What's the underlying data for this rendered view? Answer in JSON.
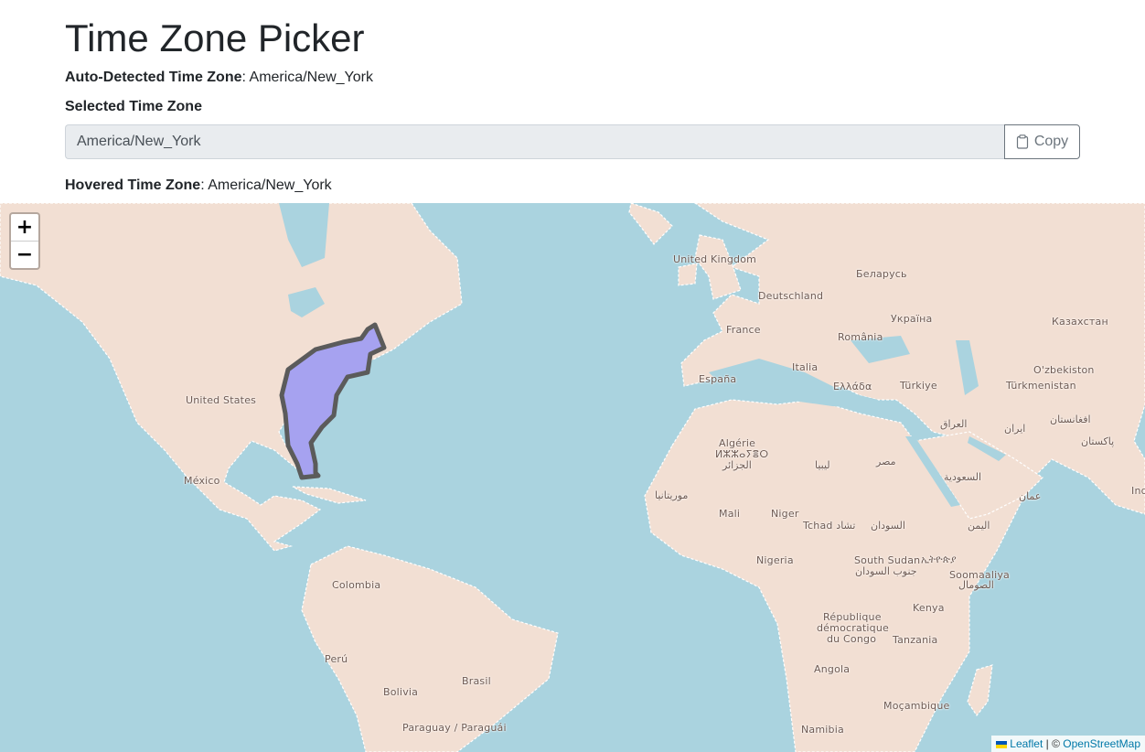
{
  "header": {
    "title": "Time Zone Picker"
  },
  "auto_detected": {
    "label": "Auto-Detected Time Zone",
    "value": "America/New_York"
  },
  "selected": {
    "label": "Selected Time Zone",
    "value": "America/New_York",
    "copy_label": "Copy"
  },
  "hovered": {
    "label": "Hovered Time Zone",
    "value": "America/New_York"
  },
  "map": {
    "zoom_in": "+",
    "zoom_out": "−",
    "highlight_color": "#a6a2f0",
    "attribution": {
      "leaflet": "Leaflet",
      "separator": " | © ",
      "osm": "OpenStreetMap"
    },
    "labels": {
      "united_kingdom": "United Kingdom",
      "belarus": "Беларусь",
      "deutschland": "Deutschland",
      "ukraine": "Україна",
      "kazakhstan": "Казахстан",
      "france": "France",
      "romania": "România",
      "uzbekistan": "O'zbekiston",
      "espana": "España",
      "italia": "Italia",
      "turkmenistan": "Türkmenistan",
      "ellada": "Ελλάδα",
      "turkiye": "Türkiye",
      "united_states": "United States",
      "iraq": "العراق",
      "iran": "ایران",
      "afghanistan": "افغانستان",
      "pakistan": "پاکستان",
      "algerie": "Algérie",
      "algerie_tif": "ⵍⵣⵣⴰⵢⴻⵔ",
      "algerie_ar": "الجزائر",
      "libya": "ليبيا",
      "misr": "مصر",
      "saudi": "السعودية",
      "mexico": "México",
      "oman": "عمان",
      "india": "Ind",
      "mauritania": "موريتانيا",
      "mali": "Mali",
      "niger": "Niger",
      "tchad": "Tchad تشاد",
      "sudan": "السودان",
      "yemen": "اليمن",
      "nigeria": "Nigeria",
      "south_sudan": "South Sudan",
      "south_sudan_ar": "جنوب السودان",
      "ethiopia": "ኢትዮጵያ",
      "somalia": "Soomaaliya",
      "somalia_ar": "الصومال",
      "colombia": "Colombia",
      "kenya": "Kenya",
      "rdc1": "République",
      "rdc2": "démocratique",
      "rdc3": "du Congo",
      "tanzania": "Tanzania",
      "peru": "Perú",
      "brasil": "Brasil",
      "angola": "Angola",
      "bolivia": "Bolivia",
      "mocambique": "Moçambique",
      "paraguay": "Paraguay / Paraguái",
      "namibia": "Namibia"
    }
  }
}
